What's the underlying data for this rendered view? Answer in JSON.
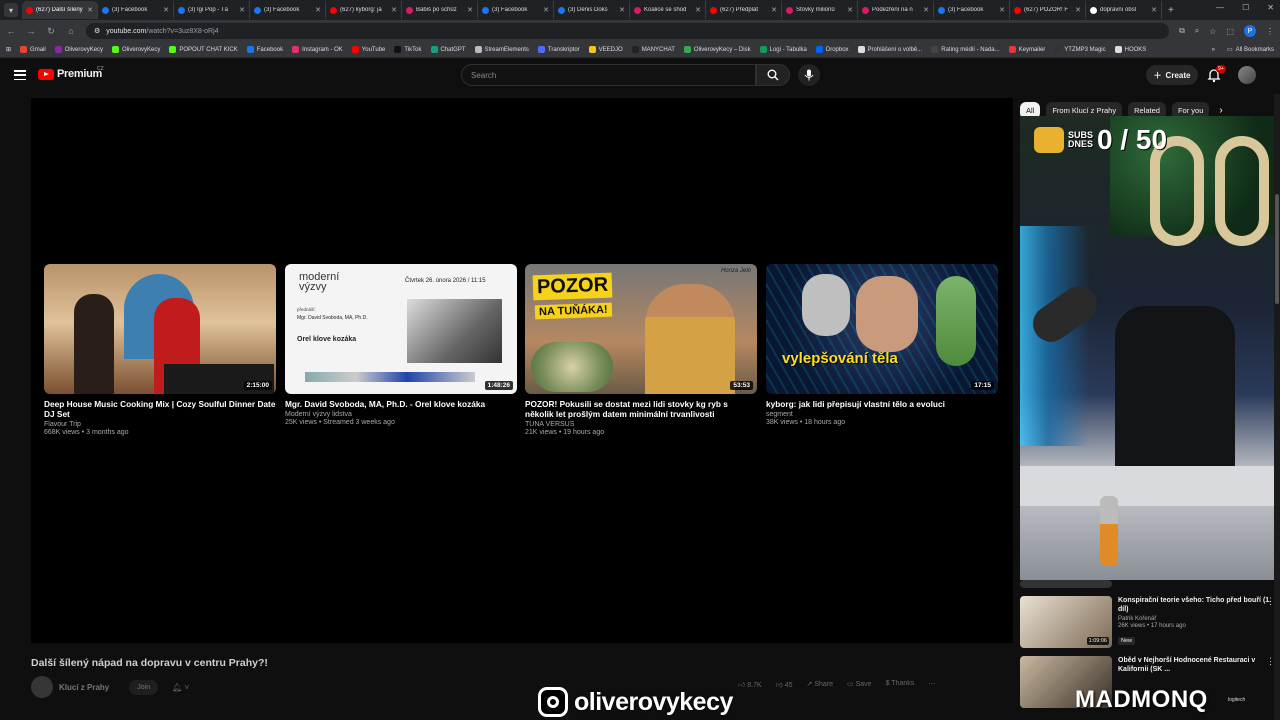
{
  "browser": {
    "tabs": [
      {
        "label": "(627) Další šílený",
        "color": "#ff0000",
        "active": true
      },
      {
        "label": "(3) Facebook",
        "color": "#1877f2"
      },
      {
        "label": "(3) Igi Pop - Tá",
        "color": "#1877f2"
      },
      {
        "label": "(3) Facebook",
        "color": "#1877f2"
      },
      {
        "label": "(627) kyborg: ja",
        "color": "#ff0000"
      },
      {
        "label": "Babiš po schůz",
        "color": "#d81b60"
      },
      {
        "label": "(3) Facebook",
        "color": "#1877f2"
      },
      {
        "label": "(3) Denis Doks",
        "color": "#1877f2"
      },
      {
        "label": "Koalice se shod",
        "color": "#d81b60"
      },
      {
        "label": "(627) Předplat",
        "color": "#ff0000"
      },
      {
        "label": "Stovky milionů",
        "color": "#d81b60"
      },
      {
        "label": "Podezření na n",
        "color": "#d81b60"
      },
      {
        "label": "(3) Facebook",
        "color": "#1877f2"
      },
      {
        "label": "(627) POZOR! F",
        "color": "#ff0000"
      },
      {
        "label": "dopravní obsl",
        "color": "#ffffff"
      }
    ],
    "new_tab": "+",
    "url_domain": "youtube.com",
    "url_path": "/watch?v=3uz8X8-oRj4",
    "profile_initial": "P",
    "bookmarks": [
      {
        "label": "Gmail",
        "color": "#ea4335"
      },
      {
        "label": "OliverovyKecy",
        "color": "#8e24aa"
      },
      {
        "label": "OliverovyKecy",
        "color": "#53fc18"
      },
      {
        "label": "POPOUT CHAT KICK",
        "color": "#53fc18"
      },
      {
        "label": "Facebook",
        "color": "#1877f2"
      },
      {
        "label": "Instagram - OK",
        "color": "#e1306c"
      },
      {
        "label": "YouTube",
        "color": "#ff0000"
      },
      {
        "label": "TikTok",
        "color": "#111111"
      },
      {
        "label": "ChatGPT",
        "color": "#10a37f"
      },
      {
        "label": "StreamElements",
        "color": "#bbbbbb"
      },
      {
        "label": "Transkriptor",
        "color": "#4a6cf7"
      },
      {
        "label": "VEEDJO",
        "color": "#f5c518"
      },
      {
        "label": "MANYCHAT",
        "color": "#222222"
      },
      {
        "label": "OliverovyKecy – Disk",
        "color": "#34a853"
      },
      {
        "label": "Logi - Tabulka",
        "color": "#0f9d58"
      },
      {
        "label": "Dropbox",
        "color": "#0061ff"
      },
      {
        "label": "Prohlášení o volbě...",
        "color": "#dddddd"
      },
      {
        "label": "Rating médií - Nada...",
        "color": "#444444"
      },
      {
        "label": "Keymailer",
        "color": "#e53935"
      },
      {
        "label": "YTZMP3 Magic",
        "color": "#333333"
      },
      {
        "label": "HOOKS",
        "color": "#dddddd"
      }
    ],
    "all_bookmarks": "All Bookmarks"
  },
  "header": {
    "logo_text": "Premium",
    "country": "CZ",
    "search_placeholder": "Search",
    "create_label": "Create",
    "notification_badge": "9+"
  },
  "endcards": [
    {
      "title": "Deep House Music Cooking Mix | Cozy Soulful Dinner Date DJ Set",
      "channel": "Flavour Trip",
      "meta": "668K views • 3 months ago",
      "duration": "2:15:00"
    },
    {
      "title": "Mgr. David Svoboda, MA, Ph.D. - Orel klove kozáka",
      "channel": "Moderní výzvy lidstva",
      "meta": "25K views • Streamed 3 weeks ago",
      "duration": "1:48:26"
    },
    {
      "title": "POZOR! Pokusili se dostat mezi lidi stovky kg ryb s několik let prošlým datem minimální trvanlivosti",
      "channel": "TUNA VERSUS",
      "meta": "21K views • 19 hours ago",
      "duration": "53:53"
    },
    {
      "title": "kyborg: jak lidi přepisují vlastní tělo a evoluci",
      "channel": "segment",
      "meta": "38K views • 18 hours ago",
      "duration": "17:15"
    }
  ],
  "thumb_text": {
    "t2_brand_line1": "moderní",
    "t2_brand_line2": "výzvy",
    "t2_date": "Čtvrtek 26. února 2026 / 11:15",
    "t2_presenter": "přednáší:",
    "t2_name": "Mgr. David Svoboda, MA, Ph.D.",
    "t2_title": "Orel klove kozáka",
    "t3_pozor": "POZOR",
    "t3_tuna": "NA TUŇÁKA!",
    "t3_brand": "Honza Jelo",
    "t4_caption": "vylepšování těla"
  },
  "video": {
    "title": "Další šílený nápad na dopravu v centru Prahy?!",
    "channel": "Klucí z Prahy",
    "join": "Join",
    "likes": "8.7K",
    "dislikes": "45",
    "share": "Share",
    "save": "Save",
    "thanks": "Thanks"
  },
  "chips": [
    "All",
    "From Klucí z Prahy",
    "Related",
    "For you"
  ],
  "webcam": {
    "subs_label_1": "SUBS",
    "subs_label_2": "DNES",
    "subs_count": "0 / 50"
  },
  "recommendations": [
    {
      "title": "Konspirační teorie všeho: Ticho před bouří (1. díl)",
      "channel": "Patrik Kořenář",
      "meta": "26K views • 17 hours ago",
      "badge": "New",
      "duration": "1:09:06"
    },
    {
      "title": "Oběd v Nejhorší Hodnocené Restauraci v Kalifornii (SK ...",
      "channel": "",
      "meta": "",
      "badge": "",
      "duration": ""
    }
  ],
  "overlays": {
    "instagram_handle": "oliverovykecy",
    "brand": "MADMONQ",
    "brand_sub": "logitech"
  }
}
